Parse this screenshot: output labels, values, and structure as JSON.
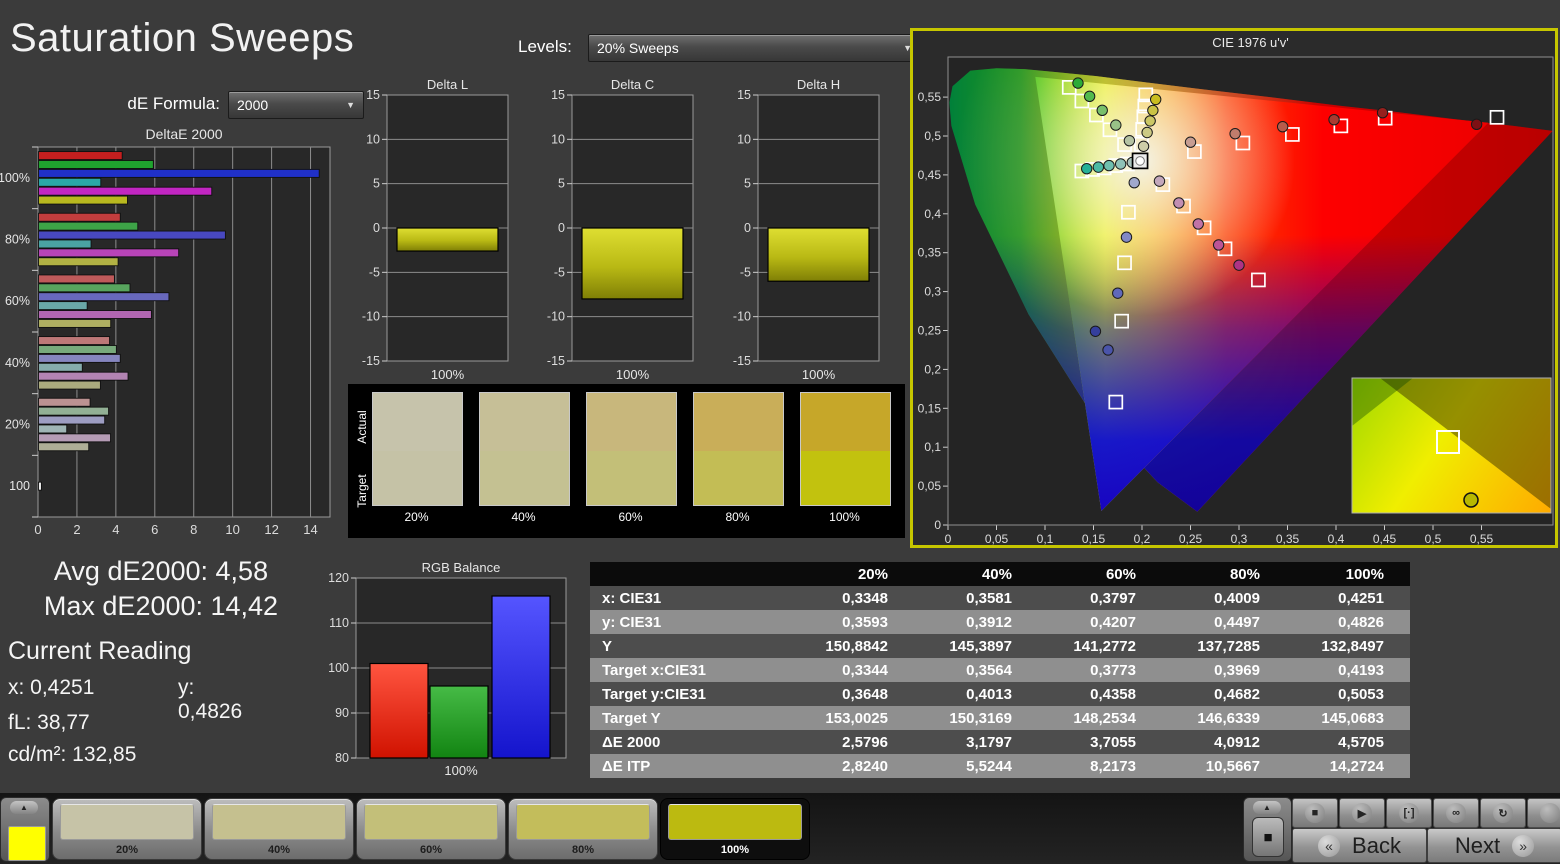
{
  "app": {
    "title": "Saturation Sweeps"
  },
  "controls": {
    "de_formula_label": "dE Formula:",
    "de_formula_value": "2000",
    "levels_label": "Levels:",
    "levels_value": "20% Sweeps",
    "dropdown_arrow": "▼"
  },
  "stats": {
    "avg": "Avg dE2000: 4,58",
    "max": "Max dE2000: 14,42",
    "current_reading_label": "Current Reading",
    "x": "x: 0,4251",
    "y": "y: 0,4826",
    "fl": "fL: 38,77",
    "cdm2": "cd/m²: 132,85"
  },
  "chart_data": [
    {
      "id": "deltae2000",
      "type": "bar",
      "orientation": "horizontal",
      "title": "DeltaE 2000",
      "xlim": [
        0,
        15
      ],
      "x_ticks": [
        0,
        2,
        4,
        6,
        8,
        10,
        12,
        14
      ],
      "series_order": [
        "red",
        "green",
        "blue",
        "cyan",
        "magenta",
        "yellow"
      ],
      "groups": [
        {
          "label": "100%",
          "values": [
            4.3,
            5.9,
            14.42,
            3.2,
            8.9,
            4.57
          ]
        },
        {
          "label": "80%",
          "values": [
            4.2,
            5.1,
            9.6,
            2.7,
            7.2,
            4.09
          ]
        },
        {
          "label": "60%",
          "values": [
            3.9,
            4.7,
            6.7,
            2.5,
            5.8,
            3.71
          ]
        },
        {
          "label": "40%",
          "values": [
            3.65,
            4.0,
            4.2,
            2.25,
            4.6,
            3.18
          ]
        },
        {
          "label": "20%",
          "values": [
            2.65,
            3.6,
            3.4,
            1.45,
            3.7,
            2.58
          ]
        },
        {
          "label": "100",
          "values": [
            0.15
          ]
        }
      ],
      "group_bar_colors": [
        [
          "#c41f1f",
          "#1fa32e",
          "#2030c8",
          "#2aa7a7",
          "#c226c2",
          "#b8b81f"
        ],
        [
          "#c23d3d",
          "#3da347",
          "#4848c0",
          "#4aa3a3",
          "#b844b8",
          "#b2b244"
        ],
        [
          "#bf5a5a",
          "#58a55e",
          "#6868bd",
          "#6aa8a8",
          "#b266b2",
          "#aeae62"
        ],
        [
          "#bd7878",
          "#78aa7c",
          "#8686bf",
          "#86acac",
          "#b384b3",
          "#abab7e"
        ],
        [
          "#bb9292",
          "#92b095",
          "#9d9dc2",
          "#9fb5b5",
          "#b59cb5",
          "#aeae96"
        ],
        [
          "#ececec"
        ]
      ]
    },
    {
      "id": "delta_l",
      "type": "bar",
      "title": "Delta L",
      "categories": [
        "100%"
      ],
      "values": [
        -2.6
      ],
      "ylim": [
        -15,
        15
      ],
      "y_ticks": [
        -15,
        -10,
        -5,
        0,
        5,
        10,
        15
      ],
      "bar_color": "#c8c81e"
    },
    {
      "id": "delta_c",
      "type": "bar",
      "title": "Delta C",
      "categories": [
        "100%"
      ],
      "values": [
        -8.0
      ],
      "ylim": [
        -15,
        15
      ],
      "y_ticks": [
        -15,
        -10,
        -5,
        0,
        5,
        10,
        15
      ],
      "bar_color": "#c8c81e"
    },
    {
      "id": "delta_h",
      "type": "bar",
      "title": "Delta H",
      "categories": [
        "100%"
      ],
      "values": [
        -6.0
      ],
      "ylim": [
        -15,
        15
      ],
      "y_ticks": [
        -15,
        -10,
        -5,
        0,
        5,
        10,
        15
      ],
      "bar_color": "#c8c81e"
    },
    {
      "id": "rgb_balance",
      "type": "bar",
      "title": "RGB Balance",
      "categories": [
        "100%"
      ],
      "ylim": [
        80,
        120
      ],
      "y_ticks": [
        80,
        90,
        100,
        110,
        120
      ],
      "series": [
        {
          "name": "Red",
          "value": 101,
          "color_top": "#ff5540",
          "color_bottom": "#d01200"
        },
        {
          "name": "Green",
          "value": 96,
          "color_top": "#46bb46",
          "color_bottom": "#128412"
        },
        {
          "name": "Blue",
          "value": 116,
          "color_top": "#5555ff",
          "color_bottom": "#1414cc"
        }
      ]
    },
    {
      "id": "swatch_compare",
      "type": "table",
      "title": "",
      "row_labels": [
        "Actual",
        "Target"
      ],
      "columns": [
        "20%",
        "40%",
        "60%",
        "80%",
        "100%"
      ],
      "actual_colors": [
        "#c6c3ab",
        "#c6bf97",
        "#c8b77c",
        "#c9ae59",
        "#c6a729"
      ],
      "target_colors": [
        "#c5c2a6",
        "#c4c192",
        "#c3bf78",
        "#c3bd55",
        "#c2c20e"
      ]
    },
    {
      "id": "cie",
      "type": "scatter",
      "title": "CIE 1976 u'v'",
      "axis_ticks": [
        "0",
        "0,05",
        "0,1",
        "0,15",
        "0,2",
        "0,25",
        "0,3",
        "0,35",
        "0,4",
        "0,45",
        "0,5",
        "0,55"
      ],
      "tick_step": 0.05,
      "white_point": {
        "u": 0.198,
        "v": 0.468
      },
      "targets": [
        [
          0.1994,
          0.4894
        ],
        [
          0.2007,
          0.5085
        ],
        [
          0.2019,
          0.5247
        ],
        [
          0.2029,
          0.5385
        ],
        [
          0.2039,
          0.5529
        ],
        [
          0.254,
          0.48
        ],
        [
          0.304,
          0.491
        ],
        [
          0.355,
          0.502
        ],
        [
          0.405,
          0.513
        ],
        [
          0.4507,
          0.5229
        ],
        [
          0.566,
          0.524
        ],
        [
          0.182,
          0.489
        ],
        [
          0.167,
          0.508
        ],
        [
          0.153,
          0.527
        ],
        [
          0.138,
          0.545
        ],
        [
          0.125,
          0.5625
        ],
        [
          0.186,
          0.402
        ],
        [
          0.182,
          0.337
        ],
        [
          0.179,
          0.262
        ],
        [
          0.173,
          0.158
        ],
        [
          0.185,
          0.464
        ],
        [
          0.173,
          0.462
        ],
        [
          0.161,
          0.459
        ],
        [
          0.149,
          0.457
        ],
        [
          0.138,
          0.455
        ],
        [
          0.2215,
          0.4375
        ],
        [
          0.2428,
          0.41
        ],
        [
          0.264,
          0.382
        ],
        [
          0.2856,
          0.355
        ],
        [
          0.32,
          0.315
        ]
      ],
      "measured": [
        [
          0.2016,
          0.4868,
          "#cecda8"
        ],
        [
          0.2053,
          0.5045,
          "#ccca84"
        ],
        [
          0.2084,
          0.5194,
          "#cbc765"
        ],
        [
          0.2112,
          0.5329,
          "#cac344"
        ],
        [
          0.2141,
          0.547,
          "#c9bd20"
        ],
        [
          0.25,
          0.492,
          "#c79d92"
        ],
        [
          0.296,
          0.503,
          "#c07c6c"
        ],
        [
          0.345,
          0.512,
          "#b85b4b"
        ],
        [
          0.398,
          0.521,
          "#a93b31"
        ],
        [
          0.448,
          0.53,
          "#96201d"
        ],
        [
          0.545,
          0.515,
          "#7d1014"
        ],
        [
          0.187,
          0.494,
          "#b5c3a3"
        ],
        [
          0.173,
          0.514,
          "#99c287"
        ],
        [
          0.159,
          0.533,
          "#78c06b"
        ],
        [
          0.146,
          0.551,
          "#52ba4e"
        ],
        [
          0.134,
          0.568,
          "#2cab38"
        ],
        [
          0.192,
          0.44,
          "#a0a8cc"
        ],
        [
          0.184,
          0.37,
          "#8289c6"
        ],
        [
          0.175,
          0.298,
          "#6069ba"
        ],
        [
          0.165,
          0.225,
          "#4a54aa"
        ],
        [
          0.152,
          0.249,
          "#353f9d"
        ],
        [
          0.19,
          0.466,
          "#aac4bd"
        ],
        [
          0.178,
          0.464,
          "#8fc2b7"
        ],
        [
          0.166,
          0.462,
          "#6fbfae"
        ],
        [
          0.155,
          0.46,
          "#4cbaa4"
        ],
        [
          0.143,
          0.458,
          "#25b097"
        ],
        [
          0.218,
          0.442,
          "#c3a7bb"
        ],
        [
          0.238,
          0.414,
          "#c28eb2"
        ],
        [
          0.258,
          0.387,
          "#c073a6"
        ],
        [
          0.279,
          0.36,
          "#bc5496"
        ],
        [
          0.3,
          0.334,
          "#ae3384"
        ]
      ]
    }
  ],
  "table": {
    "columns": [
      "",
      "20%",
      "40%",
      "60%",
      "80%",
      "100%"
    ],
    "rows": [
      {
        "label": "x: CIE31",
        "values": [
          "0,3348",
          "0,3581",
          "0,3797",
          "0,4009",
          "0,4251"
        ]
      },
      {
        "label": "y: CIE31",
        "values": [
          "0,3593",
          "0,3912",
          "0,4207",
          "0,4497",
          "0,4826"
        ]
      },
      {
        "label": "Y",
        "values": [
          "150,8842",
          "145,3897",
          "141,2772",
          "137,7285",
          "132,8497"
        ]
      },
      {
        "label": "Target x:CIE31",
        "values": [
          "0,3344",
          "0,3564",
          "0,3773",
          "0,3969",
          "0,4193"
        ]
      },
      {
        "label": "Target y:CIE31",
        "values": [
          "0,3648",
          "0,4013",
          "0,4358",
          "0,4682",
          "0,5053"
        ]
      },
      {
        "label": "Target Y",
        "values": [
          "153,0025",
          "150,3169",
          "148,2534",
          "146,6339",
          "145,0683"
        ]
      },
      {
        "label": "ΔE 2000",
        "values": [
          "2,5796",
          "3,1797",
          "3,7055",
          "4,0912",
          "4,5705"
        ]
      },
      {
        "label": "ΔE ITP",
        "values": [
          "2,8240",
          "5,5244",
          "8,2173",
          "10,5667",
          "14,2724"
        ]
      }
    ]
  },
  "bottom_bar": {
    "up_glyph": "▲",
    "stop_glyph": "■",
    "current_patch_color": "#ffff00",
    "patches": [
      {
        "label": "20%",
        "color": "#c6c3a7",
        "selected": false
      },
      {
        "label": "40%",
        "color": "#c5c08f",
        "selected": false
      },
      {
        "label": "60%",
        "color": "#c3bf79",
        "selected": false
      },
      {
        "label": "80%",
        "color": "#c3bd5b",
        "selected": false
      },
      {
        "label": "100%",
        "color": "#bcba10",
        "selected": true
      }
    ],
    "transport_icons": [
      "stop",
      "play",
      "step",
      "infinity",
      "refresh",
      "record"
    ],
    "back_label": "Back",
    "next_label": "Next",
    "back_chevron": "«",
    "next_chevron": "»"
  }
}
